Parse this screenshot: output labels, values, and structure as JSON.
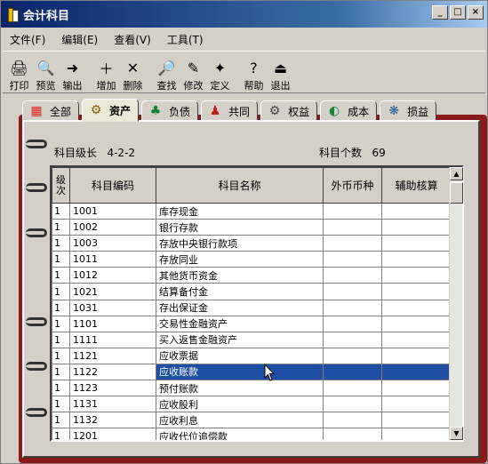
{
  "window": {
    "title": "会计科目"
  },
  "menu": [
    "文件(F)",
    "编辑(E)",
    "查看(V)",
    "工具(T)"
  ],
  "toolbar": [
    {
      "label": "打印",
      "icon": "printer-icon",
      "glyph": "🖨"
    },
    {
      "label": "预览",
      "icon": "preview-icon",
      "glyph": "🔍"
    },
    {
      "label": "输出",
      "icon": "export-icon",
      "glyph": "➜"
    },
    {
      "label": "增加",
      "icon": "add-icon",
      "glyph": "＋"
    },
    {
      "label": "删除",
      "icon": "delete-icon",
      "glyph": "✕"
    },
    {
      "label": "查找",
      "icon": "find-icon",
      "glyph": "🔎"
    },
    {
      "label": "修改",
      "icon": "edit-icon",
      "glyph": "✎"
    },
    {
      "label": "定义",
      "icon": "define-icon",
      "glyph": "✦"
    },
    {
      "label": "帮助",
      "icon": "help-icon",
      "glyph": "?"
    },
    {
      "label": "退出",
      "icon": "exit-icon",
      "glyph": "⏏"
    }
  ],
  "tabs": [
    {
      "label": "全部",
      "icon": "all-icon",
      "glyph": "▦",
      "color": "#e02020"
    },
    {
      "label": "资产",
      "icon": "assets-icon",
      "glyph": "⚙",
      "color": "#806000",
      "active": true
    },
    {
      "label": "负债",
      "icon": "liabilities-icon",
      "glyph": "♣",
      "color": "#108030"
    },
    {
      "label": "共同",
      "icon": "common-icon",
      "glyph": "♟",
      "color": "#c02020"
    },
    {
      "label": "权益",
      "icon": "equity-icon",
      "glyph": "⚙",
      "color": "#404040"
    },
    {
      "label": "成本",
      "icon": "cost-icon",
      "glyph": "◐",
      "color": "#208040"
    },
    {
      "label": "损益",
      "icon": "profit-loss-icon",
      "glyph": "❋",
      "color": "#2060a0"
    }
  ],
  "info": {
    "level_label": "科目级长",
    "level_value": "4-2-2",
    "count_label": "科目个数",
    "count_value": "69"
  },
  "grid": {
    "headers": [
      "级次",
      "科目编码",
      "科目名称",
      "外币币种",
      "辅助核算"
    ],
    "rows": [
      [
        "1",
        "1001",
        "库存现金"
      ],
      [
        "1",
        "1002",
        "银行存款"
      ],
      [
        "1",
        "1003",
        "存放中央银行款项"
      ],
      [
        "1",
        "1011",
        "存放同业"
      ],
      [
        "1",
        "1012",
        "其他货币资金"
      ],
      [
        "1",
        "1021",
        "结算备付金"
      ],
      [
        "1",
        "1031",
        "存出保证金"
      ],
      [
        "1",
        "1101",
        "交易性金融资产"
      ],
      [
        "1",
        "1111",
        "买入返售金融资产"
      ],
      [
        "1",
        "1121",
        "应收票据"
      ],
      [
        "1",
        "1122",
        "应收账款"
      ],
      [
        "1",
        "1123",
        "预付账款"
      ],
      [
        "1",
        "1131",
        "应收股利"
      ],
      [
        "1",
        "1132",
        "应收利息"
      ],
      [
        "1",
        "1201",
        "应收代位追偿款"
      ]
    ],
    "selected_index": 10,
    "selection_color": "#1f4ea5"
  }
}
